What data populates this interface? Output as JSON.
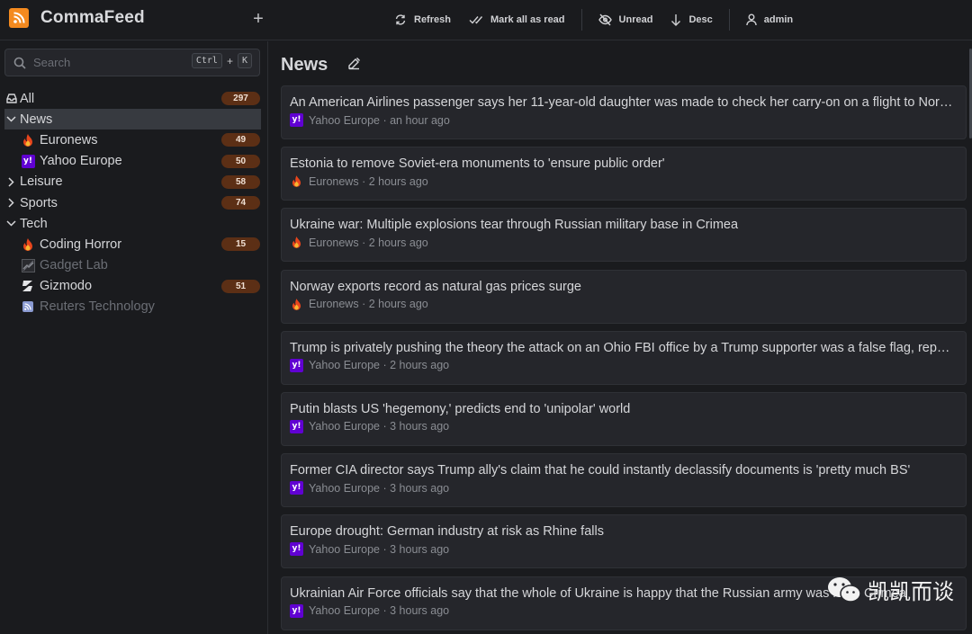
{
  "app": {
    "title": "CommaFeed"
  },
  "toolbar": {
    "refresh": "Refresh",
    "mark_all": "Mark all as read",
    "unread": "Unread",
    "desc": "Desc",
    "user": "admin"
  },
  "search": {
    "placeholder": "Search",
    "shortcut_ctrl": "Ctrl",
    "shortcut_plus": "+",
    "shortcut_key": "K"
  },
  "tree": [
    {
      "label": "All",
      "count": "297",
      "icon": "inbox-icon",
      "kind": "root"
    },
    {
      "label": "News",
      "count": "",
      "icon": "chevron-down-icon",
      "kind": "category",
      "selected": true
    },
    {
      "label": "Euronews",
      "count": "49",
      "icon": "euronews-flame-icon",
      "kind": "feed"
    },
    {
      "label": "Yahoo Europe",
      "count": "50",
      "icon": "yahoo-icon",
      "kind": "feed"
    },
    {
      "label": "Leisure",
      "count": "58",
      "icon": "chevron-right-icon",
      "kind": "category"
    },
    {
      "label": "Sports",
      "count": "74",
      "icon": "chevron-right-icon",
      "kind": "category"
    },
    {
      "label": "Tech",
      "count": "",
      "icon": "chevron-down-icon",
      "kind": "category"
    },
    {
      "label": "Coding Horror",
      "count": "15",
      "icon": "flame-icon",
      "kind": "feed"
    },
    {
      "label": "Gadget Lab",
      "count": "",
      "icon": "gadget-lab-icon",
      "kind": "feed",
      "read": true
    },
    {
      "label": "Gizmodo",
      "count": "51",
      "icon": "gizmodo-icon",
      "kind": "feed"
    },
    {
      "label": "Reuters Technology",
      "count": "",
      "icon": "rss-icon",
      "kind": "feed",
      "read": true
    }
  ],
  "main": {
    "title": "News"
  },
  "entries": [
    {
      "title": "An American Airlines passenger says her 11-year-old daughter was made to check her carry-on on a flight to North Carolina",
      "source": "Yahoo Europe",
      "time": "an hour ago",
      "src": "yahoo"
    },
    {
      "title": "Estonia to remove Soviet-era monuments to 'ensure public order'",
      "source": "Euronews",
      "time": "2 hours ago",
      "src": "euronews"
    },
    {
      "title": "Ukraine war: Multiple explosions tear through Russian military base in Crimea",
      "source": "Euronews",
      "time": "2 hours ago",
      "src": "euronews"
    },
    {
      "title": "Norway exports record as natural gas prices surge",
      "source": "Euronews",
      "time": "2 hours ago",
      "src": "euronews"
    },
    {
      "title": "Trump is privately pushing the theory the attack on an Ohio FBI office by a Trump supporter was a false flag, reports say",
      "source": "Yahoo Europe",
      "time": "2 hours ago",
      "src": "yahoo"
    },
    {
      "title": "Putin blasts US 'hegemony,' predicts end to 'unipolar' world",
      "source": "Yahoo Europe",
      "time": "3 hours ago",
      "src": "yahoo"
    },
    {
      "title": "Former CIA director says Trump ally's claim that he could instantly declassify documents is 'pretty much BS'",
      "source": "Yahoo Europe",
      "time": "3 hours ago",
      "src": "yahoo"
    },
    {
      "title": "Europe drought: German industry at risk as Rhine falls",
      "source": "Yahoo Europe",
      "time": "3 hours ago",
      "src": "yahoo"
    },
    {
      "title": "Ukrainian Air Force officials say that the whole of Ukraine is happy that the Russian army was hit in Crimea",
      "source": "Yahoo Europe",
      "time": "3 hours ago",
      "src": "yahoo"
    }
  ],
  "watermark": "凯凯而谈",
  "colors": {
    "accent": "#f48a1f",
    "badge": "#5c2f15",
    "yahoo": "#6001d2"
  }
}
